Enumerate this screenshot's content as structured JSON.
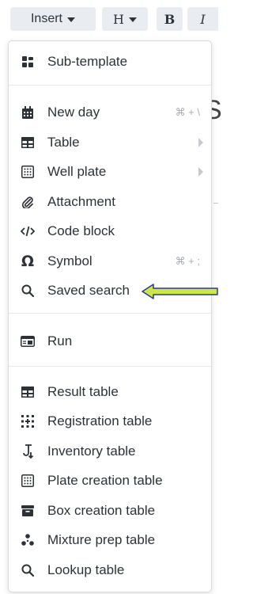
{
  "toolbar": {
    "insert_label": "Insert",
    "heading_label": "H",
    "bold_label": "B",
    "italic_label": "I"
  },
  "background": {
    "text_fragment": "S"
  },
  "menu": {
    "items": [
      {
        "label": "Sub-template",
        "icon": "sub-template-icon",
        "shortcut": "",
        "submenu": false
      },
      {
        "label": "New day",
        "icon": "calendar-icon",
        "shortcut": "⌘ + \\",
        "submenu": false
      },
      {
        "label": "Table",
        "icon": "table-icon",
        "shortcut": "",
        "submenu": true
      },
      {
        "label": "Well plate",
        "icon": "well-plate-icon",
        "shortcut": "",
        "submenu": true
      },
      {
        "label": "Attachment",
        "icon": "paperclip-icon",
        "shortcut": "",
        "submenu": false
      },
      {
        "label": "Code block",
        "icon": "code-icon",
        "shortcut": "",
        "submenu": false
      },
      {
        "label": "Symbol",
        "icon": "omega-icon",
        "shortcut": "⌘ + ;",
        "submenu": false
      },
      {
        "label": "Saved search",
        "icon": "search-icon",
        "shortcut": "",
        "submenu": false
      },
      {
        "label": "Run",
        "icon": "run-icon",
        "shortcut": "",
        "submenu": false
      },
      {
        "label": "Result table",
        "icon": "result-table-icon",
        "shortcut": "",
        "submenu": false
      },
      {
        "label": "Registration table",
        "icon": "registration-table-icon",
        "shortcut": "",
        "submenu": false
      },
      {
        "label": "Inventory table",
        "icon": "inventory-table-icon",
        "shortcut": "",
        "submenu": false
      },
      {
        "label": "Plate creation table",
        "icon": "plate-creation-icon",
        "shortcut": "",
        "submenu": false
      },
      {
        "label": "Box creation table",
        "icon": "box-creation-icon",
        "shortcut": "",
        "submenu": false
      },
      {
        "label": "Mixture prep table",
        "icon": "mixture-prep-icon",
        "shortcut": "",
        "submenu": false
      },
      {
        "label": "Lookup table",
        "icon": "search-icon",
        "shortcut": "",
        "submenu": false
      }
    ]
  },
  "annotation": {
    "arrow_color": "#cfe64a",
    "arrow_outline": "#2b3a8f",
    "points_to": "Saved search"
  },
  "colors": {
    "toolbar_button_bg": "#e9edf2",
    "menu_border": "#d7dbe0",
    "text": "#2c3238",
    "shortcut": "#a8adb3"
  }
}
